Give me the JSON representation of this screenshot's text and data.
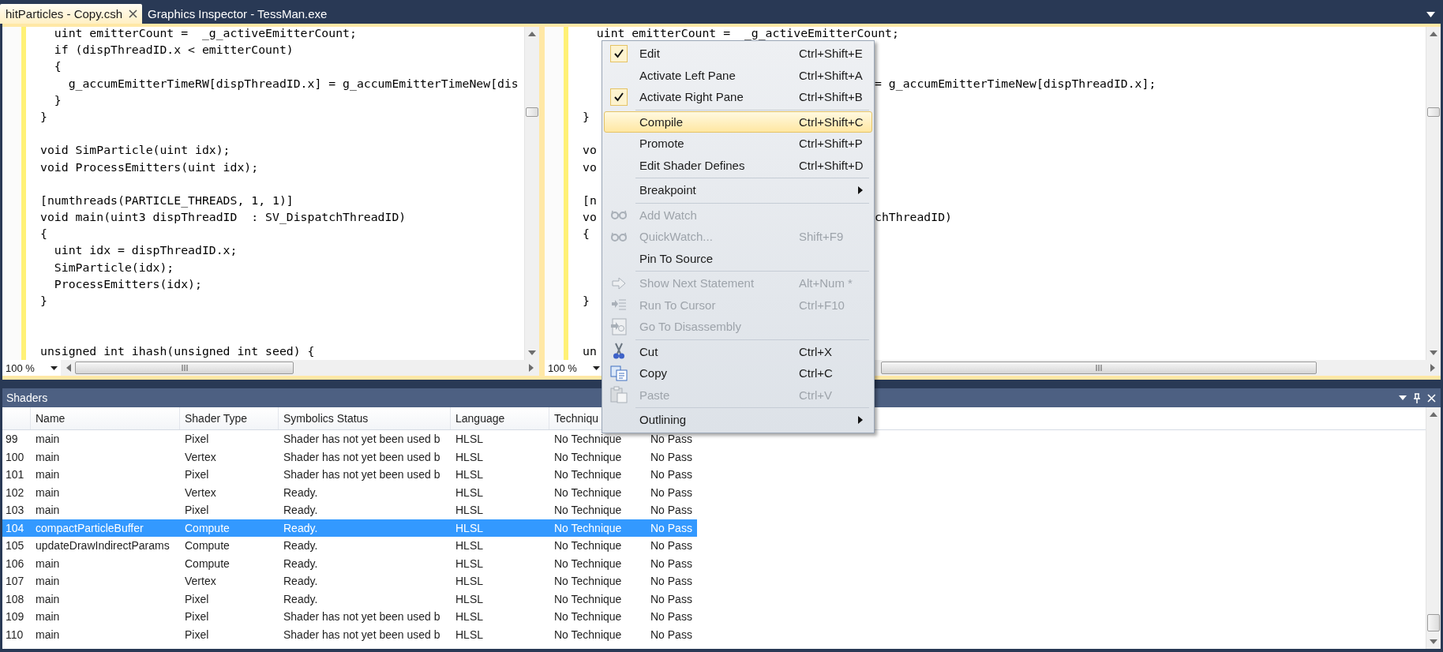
{
  "tabs": [
    {
      "label": "hitParticles - Copy.csh",
      "selected": true,
      "closable": true
    },
    {
      "label": "Graphics Inspector - TessMan.exe",
      "selected": false,
      "closable": false
    }
  ],
  "left_editor": {
    "zoom": "100 %",
    "lines": [
      {
        "kind": "code",
        "text": "  uint emitterCount =  _g_activeEmitterCount;"
      },
      {
        "kind": "code",
        "text": "  if (dispThreadID.x < emitterCount)"
      },
      {
        "kind": "code",
        "text": "  {"
      },
      {
        "kind": "code",
        "text": "    g_accumEmitterTimeRW[dispThreadID.x] = g_accumEmitterTimeNew[dis"
      },
      {
        "kind": "code",
        "text": "  }"
      },
      {
        "kind": "code",
        "text": "}"
      },
      {
        "kind": "blank"
      },
      {
        "kind": "code",
        "text": "void SimParticle(uint idx);"
      },
      {
        "kind": "code",
        "text": "void ProcessEmitters(uint idx);"
      },
      {
        "kind": "blank"
      },
      {
        "kind": "code",
        "text": "[numthreads(PARTICLE_THREADS, 1, 1)]"
      },
      {
        "kind": "code",
        "text": "void main(uint3 dispThreadID  : SV_DispatchThreadID)"
      },
      {
        "kind": "code",
        "text": "{"
      },
      {
        "kind": "code",
        "text": "  uint idx = dispThreadID.x;"
      },
      {
        "kind": "code",
        "text": "  SimParticle(idx);"
      },
      {
        "kind": "code",
        "text": "  ProcessEmitters(idx);"
      },
      {
        "kind": "code",
        "text": "}"
      },
      {
        "kind": "blank"
      },
      {
        "kind": "blank"
      },
      {
        "kind": "code",
        "text": "unsigned int ihash(unsigned int seed) {"
      }
    ]
  },
  "right_editor": {
    "zoom": "100 %",
    "lines": [
      {
        "kind": "code",
        "text": "  uint emitterCount =  _g_activeEmitterCount;"
      },
      {
        "kind": "blank"
      },
      {
        "kind": "blank"
      },
      {
        "kind": "tail",
        "tail": "= g_accumEmitterTimeNew[dispThreadID.x];"
      },
      {
        "kind": "blank"
      },
      {
        "kind": "code",
        "text": "}"
      },
      {
        "kind": "blank"
      },
      {
        "kind": "code",
        "text": "vo"
      },
      {
        "kind": "code",
        "text": "vo"
      },
      {
        "kind": "blank"
      },
      {
        "kind": "code",
        "text": "[n"
      },
      {
        "kind": "split",
        "text": "vo",
        "tail": "chThreadID)"
      },
      {
        "kind": "code",
        "text": "{"
      },
      {
        "kind": "blank"
      },
      {
        "kind": "blank"
      },
      {
        "kind": "blank"
      },
      {
        "kind": "code",
        "text": "}"
      },
      {
        "kind": "blank"
      },
      {
        "kind": "blank"
      },
      {
        "kind": "code",
        "text": "un"
      }
    ]
  },
  "context_menu": {
    "items": [
      {
        "kind": "item",
        "label": "Edit",
        "shortcut": "Ctrl+Shift+E",
        "checked": true,
        "disabled": false,
        "selected": false,
        "submenu": false
      },
      {
        "kind": "item",
        "label": "Activate Left Pane",
        "shortcut": "Ctrl+Shift+A",
        "checked": false,
        "disabled": false,
        "selected": false,
        "submenu": false
      },
      {
        "kind": "item",
        "label": "Activate Right Pane",
        "shortcut": "Ctrl+Shift+B",
        "checked": true,
        "disabled": false,
        "selected": false,
        "submenu": false
      },
      {
        "kind": "separator"
      },
      {
        "kind": "item",
        "label": "Compile",
        "shortcut": "Ctrl+Shift+C",
        "checked": false,
        "disabled": false,
        "selected": true,
        "submenu": false
      },
      {
        "kind": "item",
        "label": "Promote",
        "shortcut": "Ctrl+Shift+P",
        "checked": false,
        "disabled": false,
        "selected": false,
        "submenu": false
      },
      {
        "kind": "item",
        "label": "Edit Shader Defines",
        "shortcut": "Ctrl+Shift+D",
        "checked": false,
        "disabled": false,
        "selected": false,
        "submenu": false
      },
      {
        "kind": "separator"
      },
      {
        "kind": "item",
        "label": "Breakpoint",
        "checked": false,
        "disabled": false,
        "selected": false,
        "submenu": true
      },
      {
        "kind": "separator"
      },
      {
        "kind": "item",
        "label": "Add Watch",
        "checked": false,
        "disabled": true,
        "selected": false,
        "submenu": false
      },
      {
        "kind": "item",
        "label": "QuickWatch...",
        "shortcut": "Shift+F9",
        "checked": false,
        "disabled": true,
        "selected": false,
        "submenu": false
      },
      {
        "kind": "item",
        "label": "Pin To Source",
        "checked": false,
        "disabled": false,
        "selected": false,
        "submenu": false
      },
      {
        "kind": "separator"
      },
      {
        "kind": "item",
        "label": "Show Next Statement",
        "shortcut": "Alt+Num *",
        "checked": false,
        "disabled": true,
        "selected": false,
        "submenu": false
      },
      {
        "kind": "item",
        "label": "Run To Cursor",
        "shortcut": "Ctrl+F10",
        "checked": false,
        "disabled": true,
        "selected": false,
        "submenu": false
      },
      {
        "kind": "item",
        "label": "Go To Disassembly",
        "checked": false,
        "disabled": true,
        "selected": false,
        "submenu": false
      },
      {
        "kind": "separator"
      },
      {
        "kind": "item",
        "label": "Cut",
        "shortcut": "Ctrl+X",
        "checked": false,
        "disabled": false,
        "selected": false,
        "submenu": false
      },
      {
        "kind": "item",
        "label": "Copy",
        "shortcut": "Ctrl+C",
        "checked": false,
        "disabled": false,
        "selected": false,
        "submenu": false
      },
      {
        "kind": "item",
        "label": "Paste",
        "shortcut": "Ctrl+V",
        "checked": false,
        "disabled": true,
        "selected": false,
        "submenu": false
      },
      {
        "kind": "separator"
      },
      {
        "kind": "item",
        "label": "Outlining",
        "checked": false,
        "disabled": false,
        "selected": false,
        "submenu": true
      }
    ]
  },
  "shaders_panel": {
    "title": "Shaders",
    "columns": [
      "",
      "Name",
      "Shader Type",
      "Symbolics Status",
      "Language",
      "Techniqu"
    ],
    "rows": [
      {
        "cells": [
          "99",
          "main",
          "Pixel",
          "Shader has not yet been used b",
          "HLSL",
          "No Technique",
          "No Pass"
        ],
        "selected": false
      },
      {
        "cells": [
          "100",
          "main",
          "Vertex",
          "Shader has not yet been used b",
          "HLSL",
          "No Technique",
          "No Pass"
        ],
        "selected": false
      },
      {
        "cells": [
          "101",
          "main",
          "Pixel",
          "Shader has not yet been used b",
          "HLSL",
          "No Technique",
          "No Pass"
        ],
        "selected": false
      },
      {
        "cells": [
          "102",
          "main",
          "Vertex",
          "Ready.",
          "HLSL",
          "No Technique",
          "No Pass"
        ],
        "selected": false
      },
      {
        "cells": [
          "103",
          "main",
          "Pixel",
          "Ready.",
          "HLSL",
          "No Technique",
          "No Pass"
        ],
        "selected": false
      },
      {
        "cells": [
          "104",
          "compactParticleBuffer",
          "Compute",
          "Ready.",
          "HLSL",
          "No Technique",
          "No Pass"
        ],
        "selected": true
      },
      {
        "cells": [
          "105",
          "updateDrawIndirectParams",
          "Compute",
          "Ready.",
          "HLSL",
          "No Technique",
          "No Pass"
        ],
        "selected": false
      },
      {
        "cells": [
          "106",
          "main",
          "Compute",
          "Ready.",
          "HLSL",
          "No Technique",
          "No Pass"
        ],
        "selected": false
      },
      {
        "cells": [
          "107",
          "main",
          "Vertex",
          "Ready.",
          "HLSL",
          "No Technique",
          "No Pass"
        ],
        "selected": false
      },
      {
        "cells": [
          "108",
          "main",
          "Pixel",
          "Ready.",
          "HLSL",
          "No Technique",
          "No Pass"
        ],
        "selected": false
      },
      {
        "cells": [
          "109",
          "main",
          "Pixel",
          "Shader has not yet been used b",
          "HLSL",
          "No Technique",
          "No Pass"
        ],
        "selected": false
      },
      {
        "cells": [
          "110",
          "main",
          "Pixel",
          "Shader has not yet been used b",
          "HLSL",
          "No Technique",
          "No Pass"
        ],
        "selected": false
      }
    ]
  }
}
